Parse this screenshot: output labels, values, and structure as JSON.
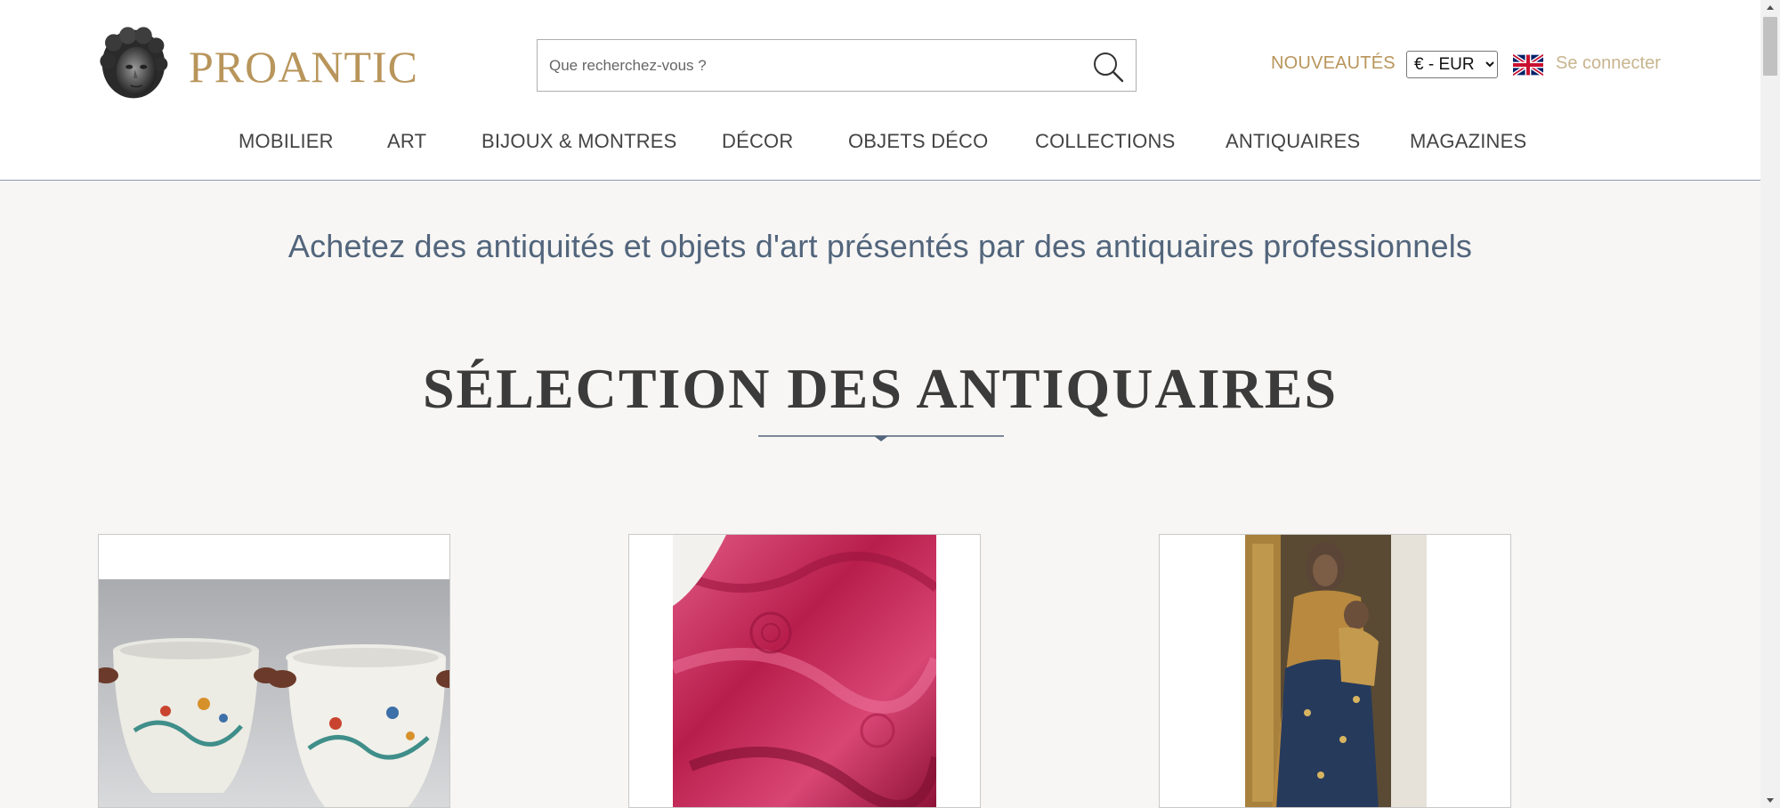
{
  "header": {
    "brand": "PROANTIC",
    "search": {
      "placeholder": "Que recherchez-vous ?",
      "value": ""
    },
    "nouveautes_label": "NOUVEAUTÉS",
    "currency": {
      "selected": "€ - EUR"
    },
    "language_icon": "uk-flag-icon",
    "login_label": "Se connecter"
  },
  "nav": {
    "items": [
      {
        "label": "MOBILIER"
      },
      {
        "label": "ART"
      },
      {
        "label": "BIJOUX & MONTRES"
      },
      {
        "label": "DÉCOR"
      },
      {
        "label": "OBJETS DÉCO"
      },
      {
        "label": "COLLECTIONS"
      },
      {
        "label": "ANTIQUAIRES"
      },
      {
        "label": "MAGAZINES"
      }
    ]
  },
  "main": {
    "tagline": "Achetez des antiquités et objets d'art présentés par des antiquaires professionnels",
    "section_title": "SÉLECTION DES ANTIQUAIRES",
    "cards": [
      {
        "image": "porcelain-planters-image"
      },
      {
        "image": "red-damask-fabric-image"
      },
      {
        "image": "virgin-and-child-statue-image"
      }
    ]
  },
  "colors": {
    "gold": "#b8955b",
    "login_gold": "#c8b48e",
    "navy": "#52657c",
    "background": "#f7f6f4"
  }
}
